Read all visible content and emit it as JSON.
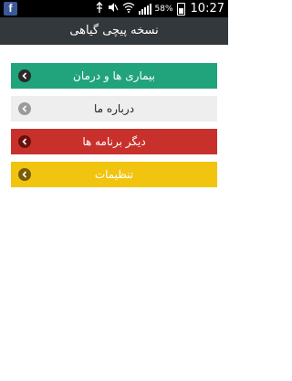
{
  "status_bar": {
    "app_icon": "facebook-icon",
    "battery_percent": "58%",
    "time": "10:27",
    "icons": [
      "usb-icon",
      "mute-icon",
      "wifi-icon",
      "signal-icon",
      "battery-icon"
    ]
  },
  "header": {
    "title": "نسخه پیچی گیاهی",
    "background": "#33383d"
  },
  "menu": {
    "items": [
      {
        "label": "بیماری ها و درمان",
        "color": "#21a37c",
        "icon": "chevron-left-icon"
      },
      {
        "label": "درباره ما",
        "color": "#eeeeee",
        "icon": "chevron-left-icon"
      },
      {
        "label": "دیگر برنامه ها",
        "color": "#c8312b",
        "icon": "chevron-left-icon"
      },
      {
        "label": "تنظیمات",
        "color": "#f1c40f",
        "icon": "chevron-left-icon"
      }
    ]
  }
}
